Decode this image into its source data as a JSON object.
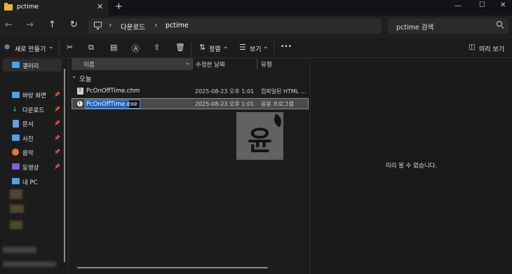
{
  "window": {
    "tab_title": "pctime",
    "close_tab": "✕",
    "new_tab": "+",
    "minimize": "—",
    "maximize": "☐",
    "close": "✕"
  },
  "nav": {
    "back": "←",
    "forward": "→",
    "up": "↑",
    "refresh": "↻",
    "breadcrumb": [
      "다운로드",
      "pctime"
    ],
    "breadcrumb_sep": "›",
    "search_placeholder": "pctime 검색"
  },
  "toolbar": {
    "new_label": "새로 만들기",
    "sort_label": "정렬",
    "view_label": "보기",
    "more": "•••",
    "details_pane_label": "미리 보기",
    "chevron": "⌄"
  },
  "sidebar": {
    "gallery": "갤러리",
    "items": [
      {
        "label": "바탕 화면",
        "icon": "desktop-icon",
        "pinned": true
      },
      {
        "label": "다운로드",
        "icon": "download-icon",
        "pinned": true
      },
      {
        "label": "문서",
        "icon": "document-icon",
        "pinned": true
      },
      {
        "label": "사진",
        "icon": "pictures-icon",
        "pinned": true
      },
      {
        "label": "음악",
        "icon": "music-icon",
        "pinned": true
      },
      {
        "label": "동영상",
        "icon": "video-icon",
        "pinned": true
      },
      {
        "label": "내 PC",
        "icon": "pc-icon",
        "pinned": false
      }
    ],
    "pin_glyph": "📌"
  },
  "file_list": {
    "columns": [
      "이름",
      "수정한 날짜",
      "유형"
    ],
    "group_label": "오늘",
    "group_chevron": "⌄",
    "files": [
      {
        "name": "PcOnOffTime.chm",
        "modified": "2025-08-23 오후 1:01",
        "type": "컴파일된 HTML ...",
        "icon": "chm-file-icon",
        "selected": false
      },
      {
        "name": "PcOnOffTime.exe",
        "modified": "2025-08-23 오후 1:01",
        "type": "응용 프로그램",
        "icon": "exe-file-icon",
        "selected": true,
        "renaming": true
      }
    ]
  },
  "watermark_char": "윤",
  "preview": {
    "empty_text": "미리 볼 수 없습니다."
  },
  "colors": {
    "background": "#1c1c1c",
    "selection": "#4a4a4a",
    "rename_highlight": "#1f5fb5",
    "folder": "#e8b63c"
  }
}
